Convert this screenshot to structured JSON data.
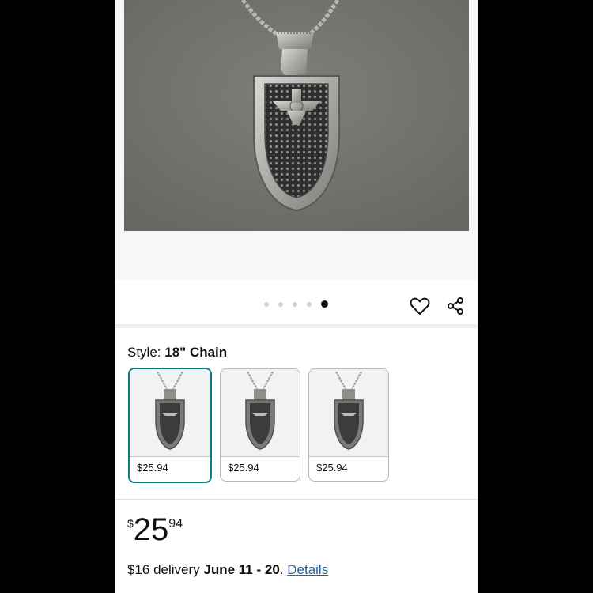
{
  "gallery": {
    "image_count": 5,
    "active_index": 4,
    "image_subject": "silver shield pendant necklace"
  },
  "icons": {
    "wishlist": "heart-outline-icon",
    "share": "share-icon"
  },
  "style": {
    "label": "Style: ",
    "selected_value": "18\" Chain",
    "options": [
      {
        "price": "$25.94",
        "selected": true
      },
      {
        "price": "$25.94",
        "selected": false
      },
      {
        "price": "$25.94",
        "selected": false
      }
    ]
  },
  "price": {
    "symbol": "$",
    "whole": "25",
    "fraction": "94"
  },
  "delivery": {
    "fee_text": "$16 delivery ",
    "dates": "June 11 - 20",
    "separator": ". ",
    "link": "Details"
  },
  "colors": {
    "accent_teal": "#0d7c8a",
    "link": "#2162a1",
    "text": "#0f1111"
  }
}
